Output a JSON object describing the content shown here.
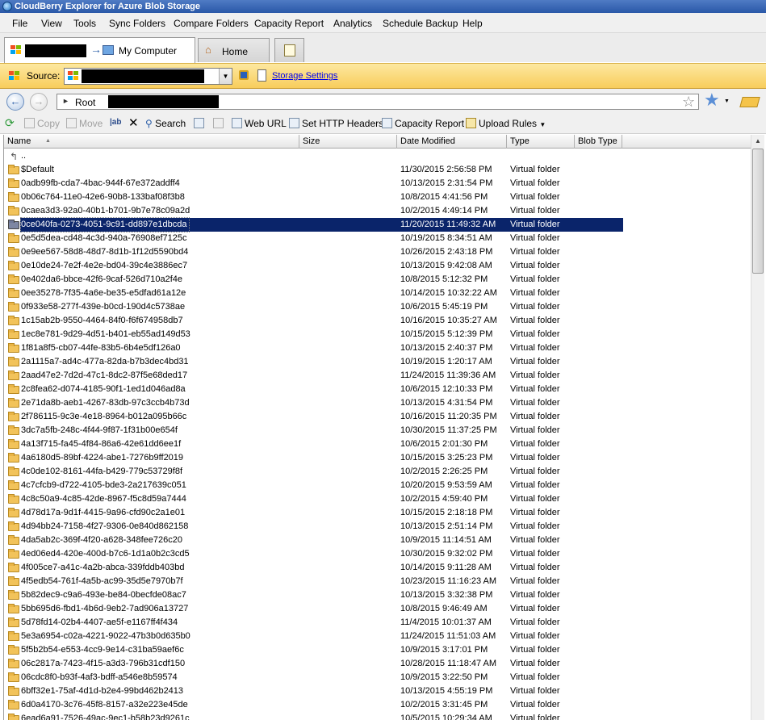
{
  "window": {
    "title": "CloudBerry Explorer for Azure Blob Storage"
  },
  "menu": [
    "File",
    "View",
    "Tools",
    "Sync Folders",
    "Compare Folders",
    "Capacity Report",
    "Analytics",
    "Schedule Backup",
    "Help"
  ],
  "tabs": {
    "active_label": "My Computer",
    "home_label": "Home"
  },
  "source": {
    "label": "Source:",
    "storage_settings": "Storage Settings"
  },
  "address": {
    "root": "Root"
  },
  "toolbar": {
    "copy": "Copy",
    "move": "Move",
    "search": "Search",
    "web_url": "Web URL",
    "http_headers": "Set HTTP Headers",
    "capacity_report": "Capacity Report",
    "upload_rules": "Upload Rules"
  },
  "columns": {
    "name": "Name",
    "size": "Size",
    "date": "Date Modified",
    "type": "Type",
    "blob_type": "Blob Type"
  },
  "parent_row": "..",
  "selected_index": 4,
  "rows": [
    {
      "name": "$Default",
      "date": "11/30/2015 2:56:58 PM",
      "type": "Virtual folder"
    },
    {
      "name": "0adb99fb-cda7-4bac-944f-67e372addff4",
      "date": "10/13/2015 2:31:54 PM",
      "type": "Virtual folder"
    },
    {
      "name": "0b06c764-11e0-42e6-90b8-133baf08f3b8",
      "date": "10/8/2015 4:41:56 PM",
      "type": "Virtual folder"
    },
    {
      "name": "0caea3d3-92a0-40b1-b701-9b7e78c09a2d",
      "date": "10/2/2015 4:49:14 PM",
      "type": "Virtual folder"
    },
    {
      "name": "0ce040fa-0273-4051-9c91-dd897e1dbcda",
      "date": "11/20/2015 11:49:32 AM",
      "type": "Virtual folder"
    },
    {
      "name": "0e5d5dea-cd48-4c3d-940a-76908ef7125c",
      "date": "10/19/2015 8:34:51 AM",
      "type": "Virtual folder"
    },
    {
      "name": "0e9ee567-58d8-48d7-8d1b-1f12d5590bd4",
      "date": "10/26/2015 2:43:18 PM",
      "type": "Virtual folder"
    },
    {
      "name": "0e10de24-7e2f-4e2e-bd04-39c4e3886ec7",
      "date": "10/13/2015 9:42:08 AM",
      "type": "Virtual folder"
    },
    {
      "name": "0e402da6-bbce-42f6-9caf-526d710a2f4e",
      "date": "10/8/2015 5:12:32 PM",
      "type": "Virtual folder"
    },
    {
      "name": "0ee35278-7f35-4a6e-be35-e5dfad61a12e",
      "date": "10/14/2015 10:32:22 AM",
      "type": "Virtual folder"
    },
    {
      "name": "0f933e58-277f-439e-b0cd-190d4c5738ae",
      "date": "10/6/2015 5:45:19 PM",
      "type": "Virtual folder"
    },
    {
      "name": "1c15ab2b-9550-4464-84f0-f6f674958db7",
      "date": "10/16/2015 10:35:27 AM",
      "type": "Virtual folder"
    },
    {
      "name": "1ec8e781-9d29-4d51-b401-eb55ad149d53",
      "date": "10/15/2015 5:12:39 PM",
      "type": "Virtual folder"
    },
    {
      "name": "1f81a8f5-cb07-44fe-83b5-6b4e5df126a0",
      "date": "10/13/2015 2:40:37 PM",
      "type": "Virtual folder"
    },
    {
      "name": "2a1115a7-ad4c-477a-82da-b7b3dec4bd31",
      "date": "10/19/2015 1:20:17 AM",
      "type": "Virtual folder"
    },
    {
      "name": "2aad47e2-7d2d-47c1-8dc2-87f5e68ded17",
      "date": "11/24/2015 11:39:36 AM",
      "type": "Virtual folder"
    },
    {
      "name": "2c8fea62-d074-4185-90f1-1ed1d046ad8a",
      "date": "10/6/2015 12:10:33 PM",
      "type": "Virtual folder"
    },
    {
      "name": "2e71da8b-aeb1-4267-83db-97c3ccb4b73d",
      "date": "10/13/2015 4:31:54 PM",
      "type": "Virtual folder"
    },
    {
      "name": "2f786115-9c3e-4e18-8964-b012a095b66c",
      "date": "10/16/2015 11:20:35 PM",
      "type": "Virtual folder"
    },
    {
      "name": "3dc7a5fb-248c-4f44-9f87-1f31b00e654f",
      "date": "10/30/2015 11:37:25 PM",
      "type": "Virtual folder"
    },
    {
      "name": "4a13f715-fa45-4f84-86a6-42e61dd6ee1f",
      "date": "10/6/2015 2:01:30 PM",
      "type": "Virtual folder"
    },
    {
      "name": "4a6180d5-89bf-4224-abe1-7276b9ff2019",
      "date": "10/15/2015 3:25:23 PM",
      "type": "Virtual folder"
    },
    {
      "name": "4c0de102-8161-44fa-b429-779c53729f8f",
      "date": "10/2/2015 2:26:25 PM",
      "type": "Virtual folder"
    },
    {
      "name": "4c7cfcb9-d722-4105-bde3-2a217639c051",
      "date": "10/20/2015 9:53:59 AM",
      "type": "Virtual folder"
    },
    {
      "name": "4c8c50a9-4c85-42de-8967-f5c8d59a7444",
      "date": "10/2/2015 4:59:40 PM",
      "type": "Virtual folder"
    },
    {
      "name": "4d78d17a-9d1f-4415-9a96-cfd90c2a1e01",
      "date": "10/15/2015 2:18:18 PM",
      "type": "Virtual folder"
    },
    {
      "name": "4d94bb24-7158-4f27-9306-0e840d862158",
      "date": "10/13/2015 2:51:14 PM",
      "type": "Virtual folder"
    },
    {
      "name": "4da5ab2c-369f-4f20-a628-348fee726c20",
      "date": "10/9/2015 11:14:51 AM",
      "type": "Virtual folder"
    },
    {
      "name": "4ed06ed4-420e-400d-b7c6-1d1a0b2c3cd5",
      "date": "10/30/2015 9:32:02 PM",
      "type": "Virtual folder"
    },
    {
      "name": "4f005ce7-a41c-4a2b-abca-339fddb403bd",
      "date": "10/14/2015 9:11:28 AM",
      "type": "Virtual folder"
    },
    {
      "name": "4f5edb54-761f-4a5b-ac99-35d5e7970b7f",
      "date": "10/23/2015 11:16:23 AM",
      "type": "Virtual folder"
    },
    {
      "name": "5b82dec9-c9a6-493e-be84-0becfde08ac7",
      "date": "10/13/2015 3:32:38 PM",
      "type": "Virtual folder"
    },
    {
      "name": "5bb695d6-fbd1-4b6d-9eb2-7ad906a13727",
      "date": "10/8/2015 9:46:49 AM",
      "type": "Virtual folder"
    },
    {
      "name": "5d78fd14-02b4-4407-ae5f-e1167ff4f434",
      "date": "11/4/2015 10:01:37 AM",
      "type": "Virtual folder"
    },
    {
      "name": "5e3a6954-c02a-4221-9022-47b3b0d635b0",
      "date": "11/24/2015 11:51:03 AM",
      "type": "Virtual folder"
    },
    {
      "name": "5f5b2b54-e553-4cc9-9e14-c31ba59aef6c",
      "date": "10/9/2015 3:17:01 PM",
      "type": "Virtual folder"
    },
    {
      "name": "06c2817a-7423-4f15-a3d3-796b31cdf150",
      "date": "10/28/2015 11:18:47 AM",
      "type": "Virtual folder"
    },
    {
      "name": "06cdc8f0-b93f-4af3-bdff-a546e8b59574",
      "date": "10/9/2015 3:22:50 PM",
      "type": "Virtual folder"
    },
    {
      "name": "6bff32e1-75af-4d1d-b2e4-99bd462b2413",
      "date": "10/13/2015 4:55:19 PM",
      "type": "Virtual folder"
    },
    {
      "name": "6d0a4170-3c76-45f8-8157-a32e223e45de",
      "date": "10/2/2015 3:31:45 PM",
      "type": "Virtual folder"
    },
    {
      "name": "6ead6a91-7526-49ac-9ec1-b58b23d9261c",
      "date": "10/5/2015 10:29:34 AM",
      "type": "Virtual folder"
    }
  ]
}
